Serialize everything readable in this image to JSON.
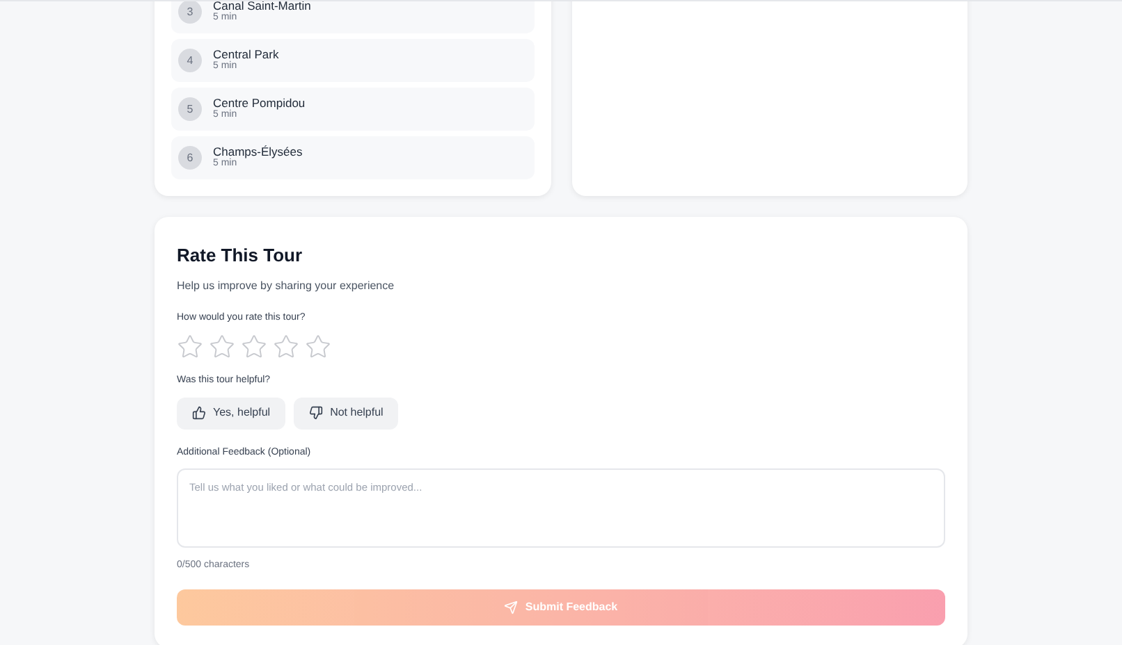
{
  "stops": [
    {
      "number": "3",
      "name": "Canal Saint-Martin",
      "duration": "5 min"
    },
    {
      "number": "4",
      "name": "Central Park",
      "duration": "5 min"
    },
    {
      "number": "5",
      "name": "Centre Pompidou",
      "duration": "5 min"
    },
    {
      "number": "6",
      "name": "Champs-Élysées",
      "duration": "5 min"
    }
  ],
  "rating": {
    "title": "Rate This Tour",
    "subtitle": "Help us improve by sharing your experience",
    "question": "How would you rate this tour?",
    "stars": 0,
    "helpful_question": "Was this tour helpful?",
    "helpful_options": [
      {
        "kind": "up",
        "label": "Yes, helpful",
        "selected": false
      },
      {
        "kind": "down",
        "label": "Not helpful",
        "selected": false
      }
    ],
    "feedback_label": "Additional Feedback (Optional)",
    "placeholder": "Tell us what you liked or what could be improved...",
    "counter": "0/500 characters",
    "submit": {
      "label": "Submit Feedback",
      "disabled": true
    }
  }
}
